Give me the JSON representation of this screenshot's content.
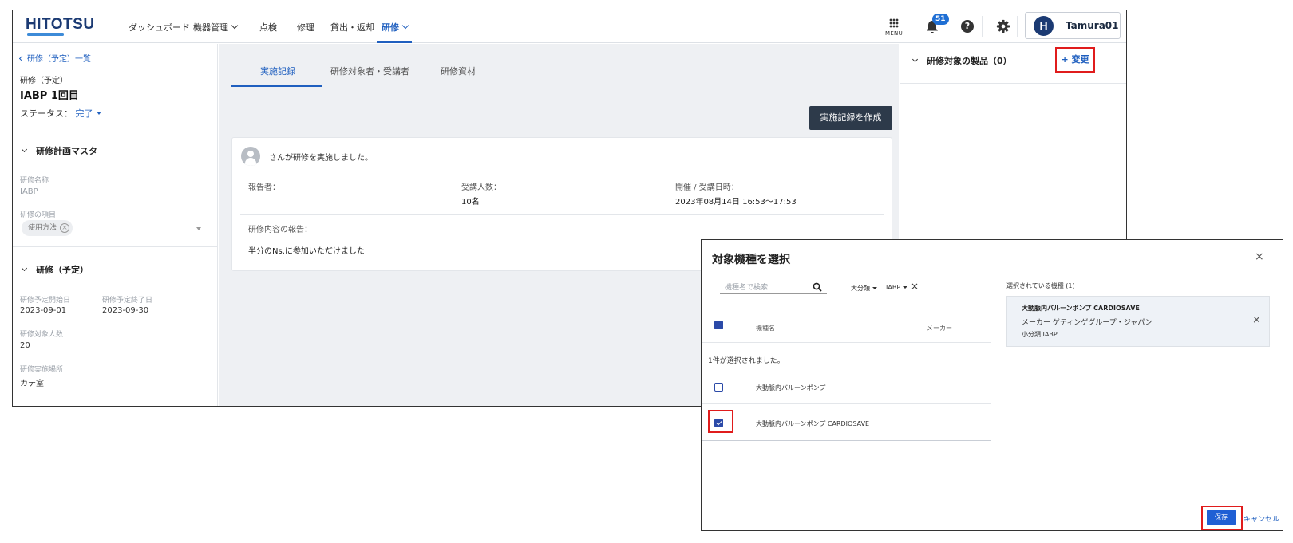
{
  "header": {
    "logo": "HITOTSU",
    "nav": [
      {
        "label": "ダッシュボード"
      },
      {
        "label": "機器管理"
      },
      {
        "label": "点検"
      },
      {
        "label": "修理"
      },
      {
        "label": "貸出・返却"
      },
      {
        "label": "研修"
      }
    ],
    "menu_label": "MENU",
    "notification_count": "51",
    "help_icon": "?",
    "user_initial": "H",
    "user_name": "Tamura01",
    "accent_color": "#1f5fbf"
  },
  "left": {
    "back_link": "研修（予定）一覧",
    "training_type": "研修（予定）",
    "training_title": "IABP 1回目",
    "status_label": "ステータス：",
    "status_value": "完了",
    "section_master": "研修計画マスタ",
    "name_label": "研修名称",
    "name_value": "IABP",
    "items_label": "研修の項目",
    "items_chip": "使用方法",
    "section_planned": "研修（予定）",
    "start_label": "研修予定開始日",
    "start_value": "2023-09-01",
    "end_label": "研修予定終了日",
    "end_value": "2023-09-30",
    "target_label": "研修対象人数",
    "target_value": "20",
    "place_label": "研修実施場所",
    "place_value": "カテ室"
  },
  "center": {
    "tabs": [
      {
        "label": "実施記録"
      },
      {
        "label": "研修対象者・受講者"
      },
      {
        "label": "研修資材"
      }
    ],
    "create_button": "実施記録を作成",
    "record": {
      "header": "さんが研修を実施しました。",
      "reporter_label": "報告者：",
      "attendees_label": "受講人数：",
      "attendees_value": "10名",
      "datetime_label": "開催 / 受講日時：",
      "datetime_value": "2023年08月14日 16:53〜17:53",
      "content_label": "研修内容の報告：",
      "content_value": "半分のNs.に参加いただけました"
    }
  },
  "right": {
    "header": "研修対象の製品（0）",
    "change_link": "+ 変更"
  },
  "modal": {
    "title": "対象機種を選択",
    "close": "×",
    "search_placeholder": "機種名で検索",
    "filter_category": "大分類",
    "filter_value": "IABP",
    "filter_clear": "×",
    "col_name": "機種名",
    "col_maker": "メーカー",
    "selected_count": "1件が選択されました。",
    "rows": [
      {
        "name": "大動脈内バルーンポンプ",
        "checked": false
      },
      {
        "name": "大動脈内バルーンポンプ CARDIOSAVE",
        "checked": true
      }
    ],
    "selected_head": "選択されている機種 (1)",
    "selected_item": {
      "name": "大動脈内バルーンポンプ CARDIOSAVE",
      "maker": "メーカー ゲティンゲグループ・ジャパン",
      "subcategory": "小分類 IABP",
      "remove": "×"
    },
    "save_button": "保存",
    "cancel_link": "キャンセル"
  }
}
